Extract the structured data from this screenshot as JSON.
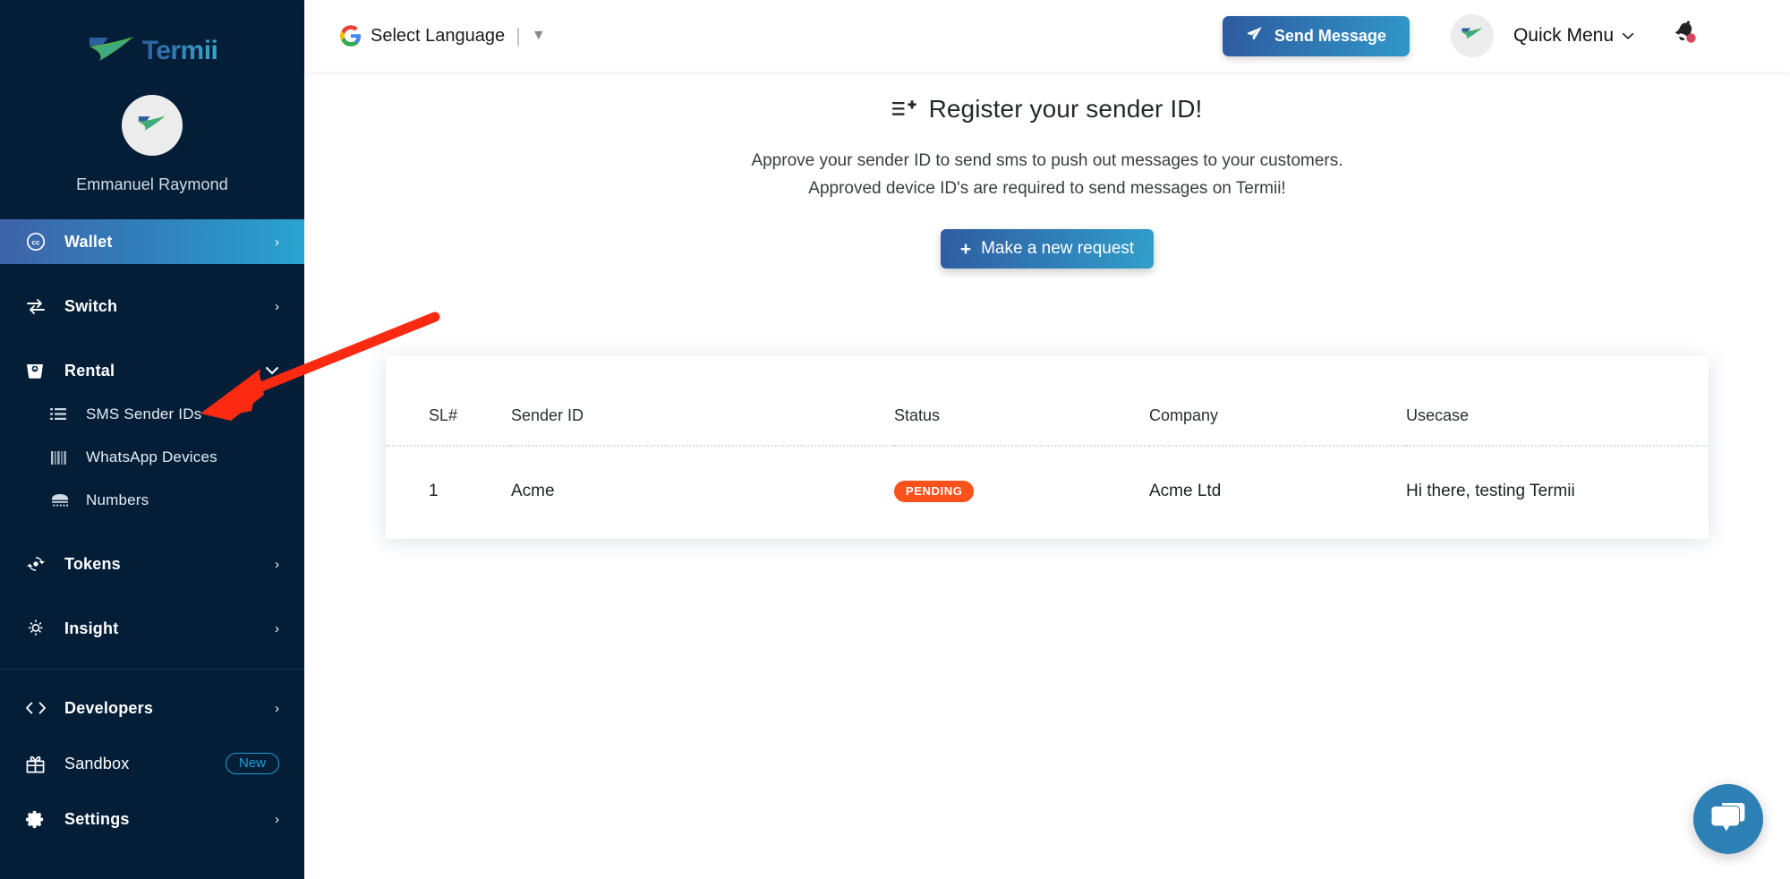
{
  "brand": {
    "name": "Termii",
    "logo_icon": "termii-bird-logo"
  },
  "sidebar": {
    "user": {
      "name": "Emmanuel Raymond",
      "avatar_icon": "termii-bird-avatar"
    },
    "items": [
      {
        "label": "Wallet",
        "icon": "coins-circle-icon",
        "chevron": "›",
        "active": true
      },
      {
        "label": "Switch",
        "icon": "switch-arrows-icon",
        "chevron": "›",
        "active": false
      },
      {
        "label": "Rental",
        "icon": "rental-basket-icon",
        "chevron": "⌄",
        "active": false
      }
    ],
    "sub_items": [
      {
        "label": "SMS Sender IDs",
        "icon": "list-icon"
      },
      {
        "label": "WhatsApp Devices",
        "icon": "devices-bars-icon"
      },
      {
        "label": "Numbers",
        "icon": "keypad-icon"
      }
    ],
    "items_2": [
      {
        "label": "Tokens",
        "icon": "token-icon",
        "chevron": "›"
      },
      {
        "label": "Insight",
        "icon": "insight-sun-icon",
        "chevron": "›"
      }
    ],
    "items_3": [
      {
        "label": "Developers",
        "icon": "code-brackets-icon",
        "chevron": "›",
        "badge": ""
      },
      {
        "label": "Sandbox",
        "icon": "gift-icon",
        "chevron": "",
        "badge": "New"
      },
      {
        "label": "Settings",
        "icon": "gear-icon",
        "chevron": "›",
        "badge": ""
      }
    ]
  },
  "topbar": {
    "language": {
      "icon": "google-g-icon",
      "label": "Select Language",
      "separator": "|",
      "caret": "▼"
    },
    "send_message": {
      "label": "Send Message",
      "icon": "paper-plane-icon"
    },
    "quick_menu": {
      "label": "Quick Menu",
      "caret": "⌄",
      "avatar_icon": "termii-bird-avatar"
    },
    "notifications": {
      "icon": "bell-icon",
      "has_unread": true,
      "dot_color": "#d6455c"
    }
  },
  "hero": {
    "icon": "list-plus-icon",
    "title": "Register your sender ID!",
    "subtitle_line1": "Approve your sender ID to send sms to push out messages to your customers.",
    "subtitle_line2": "Approved device ID's are required to send messages on Termii!",
    "cta": {
      "label": "Make a new request",
      "icon": "plus-icon"
    }
  },
  "table": {
    "columns": [
      "SL#",
      "Sender ID",
      "Status",
      "Company",
      "Usecase"
    ],
    "rows": [
      {
        "sl": "1",
        "sender_id": "Acme",
        "status": "PENDING",
        "status_color": "#fb511b",
        "company": "Acme Ltd",
        "usecase": "Hi there, testing Termii"
      }
    ]
  },
  "chat_widget": {
    "icon": "chat-bubbles-icon",
    "color": "#2d80b4"
  },
  "annotation": {
    "type": "arrow",
    "color": "#fb2a10",
    "points_to": "SMS Sender IDs"
  },
  "colors": {
    "sidebar_bg": "#041e38",
    "accent_blue": "#2f84bd",
    "status_orange": "#fb511b",
    "badge_blue": "#1f9fd6"
  }
}
